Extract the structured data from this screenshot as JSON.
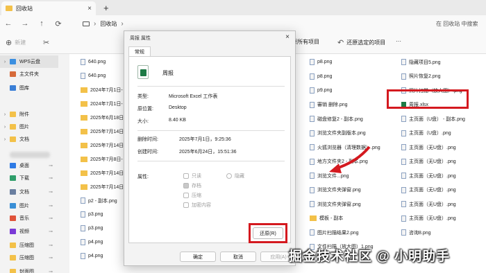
{
  "tab": {
    "title": "回收站",
    "close": "×",
    "new": "+"
  },
  "nav": {
    "back": "←",
    "forward": "→",
    "up": "↑",
    "refresh": "⟳",
    "crumb": "回收站",
    "crumb_sep": "›",
    "search_placeholder": "在 回收站 中搜索"
  },
  "toolbar": {
    "new_label": "新建",
    "restore_all": "还原所有项目",
    "restore_selected": "还原选定的项目",
    "more": "···"
  },
  "sidebar": [
    {
      "label": "WPS云盘",
      "icon": "cloud-icon",
      "color": "#3b8fe0",
      "chev": "›"
    },
    {
      "label": "主文件夹",
      "icon": "home-icon",
      "color": "#d66a3a",
      "chev": ""
    },
    {
      "label": "图库",
      "icon": "gallery-icon",
      "color": "#3a7fd6",
      "chev": ""
    },
    {
      "label": "附件",
      "icon": "folder-icon",
      "color": "#f3c149",
      "chev": "›"
    },
    {
      "label": "图片",
      "icon": "folder-icon",
      "color": "#f3c149",
      "chev": "›"
    },
    {
      "label": "文档",
      "icon": "folder-icon",
      "color": "#f3c149",
      "chev": "›"
    },
    {
      "label": "桌面",
      "icon": "desktop-icon",
      "color": "#2f7be5",
      "chev": ""
    },
    {
      "label": "下载",
      "icon": "download-icon",
      "color": "#2f9e6a",
      "chev": ""
    },
    {
      "label": "文档",
      "icon": "document-icon",
      "color": "#6a7fa0",
      "chev": ""
    },
    {
      "label": "图片",
      "icon": "picture-icon",
      "color": "#3a8fd6",
      "chev": ""
    },
    {
      "label": "音乐",
      "icon": "music-icon",
      "color": "#e0533a",
      "chev": ""
    },
    {
      "label": "视频",
      "icon": "video-icon",
      "color": "#7a3ad6",
      "chev": ""
    },
    {
      "label": "压缩图",
      "icon": "folder-icon",
      "color": "#f3c149",
      "chev": ""
    },
    {
      "label": "压缩图",
      "icon": "folder-icon",
      "color": "#f3c149",
      "chev": ""
    },
    {
      "label": "封面图",
      "icon": "folder-icon",
      "color": "#f3c149",
      "chev": ""
    }
  ],
  "files_col1": [
    "640.png",
    "640.png",
    "2024年7月1日-",
    "2024年7月1日-",
    "2025年6月18日",
    "2025年7月14日",
    "2025年7月14日",
    "2025年7月8日-",
    "2025年7月14日",
    "2025年7月14日",
    "p2 - 副本.png",
    "p3.png",
    "p3.png",
    "p4.png",
    "p4.png"
  ],
  "files_col3": [
    "p8.png",
    "p8.png",
    "p9.png",
    "審销 删除.png",
    "磁盘修复2 - 副本.png",
    "浏览文件夹副版本.png",
    "火狐浏览器（清理数据）.png",
    "地方文件夹2 - 副本.png",
    "浏览文件...png",
    "浏览文件夹弹窗.png",
    "浏览文件夹弹窗.png",
    "模板 - 副本",
    "图片扫描结果2.png",
    "文件扫描（放大图）1.png"
  ],
  "files_col4": [
    "隐藏项目5.png",
    "照片恢复2.png",
    "照片扫描（放大图）.png",
    "周报.xlsx",
    "主页面（U盘） - 副本.png",
    "主页面（U盘）.png",
    "主页面（无U盘）.png",
    "主页面（无U盘）.png",
    "主页面（无U盘）.png",
    "主页面（无U盘）.png",
    "主页面（无U盘）.png",
    "主页面（无U盘）.png",
    "咨询8.png"
  ],
  "dialog": {
    "title": "周报 属性",
    "close": "×",
    "tab": "常规",
    "filename": "周报",
    "type_label": "类型:",
    "type_value": "Microsoft Excel 工作表",
    "origin_label": "原位置:",
    "origin_value": "Desktop",
    "size_label": "大小:",
    "size_value": "8.40 KB",
    "deleted_label": "删除时间:",
    "deleted_value": "2025年7月1日，9:25:36",
    "created_label": "创建时间:",
    "created_value": "2025年6月24日，15:51:36",
    "attr_label": "属性:",
    "attrs": [
      "只读",
      "隐藏",
      "存档",
      "压缩",
      "加密内容"
    ],
    "restore": "还原(R)",
    "ok": "确定",
    "cancel": "取消",
    "apply": "应用(A)"
  },
  "colors": {
    "highlight": "#d4191f",
    "excel": "#1d7a45"
  },
  "watermark": "掘金技术社区 @ 小明助手"
}
